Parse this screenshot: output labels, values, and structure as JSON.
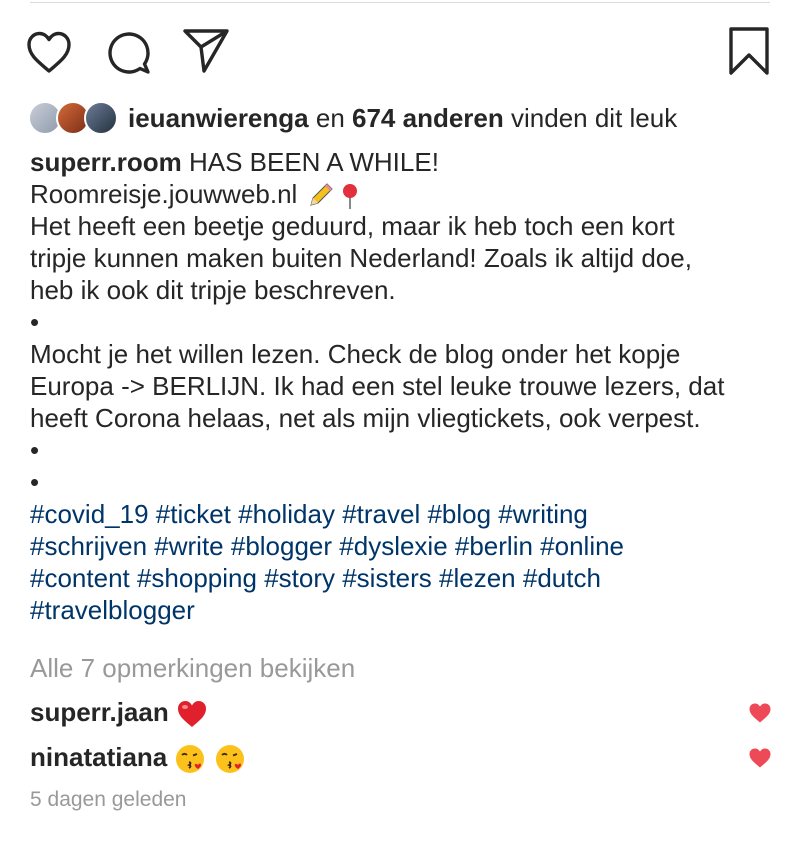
{
  "likes": {
    "user": "ieuanwierenga",
    "connector": "en",
    "count": "674 anderen",
    "suffix": "vinden dit leuk"
  },
  "caption": {
    "username": "superr.room",
    "title": "HAS BEEN A WHILE!",
    "link": "Roomreisje.jouwweb.nl",
    "body_lines": [
      "Het heeft een beetje geduurd, maar ik heb toch een kort",
      "tripje kunnen maken buiten Nederland! Zoals ik altijd doe,",
      "heb ik ook dit tripje beschreven."
    ],
    "dot": "•",
    "body2_lines": [
      "Mocht je het willen lezen. Check de blog onder het kopje",
      "Europa -> BERLIJN. Ik had een stel leuke trouwe lezers, dat",
      "heeft Corona helaas, net als mijn vliegtickets, ook verpest."
    ],
    "hashtag_lines": [
      "#covid_19 #ticket #holiday #travel #blog #writing",
      "#schrijven #write #blogger #dyslexie #berlin #online",
      "#content #shopping #story #sisters #lezen #dutch",
      "#travelblogger"
    ]
  },
  "view_all_comments": "Alle 7 opmerkingen bekijken",
  "comments": [
    {
      "user": "superr.jaan",
      "emoji": [
        "red-heart"
      ]
    },
    {
      "user": "ninatatiana",
      "emoji": [
        "kissing-face",
        "kissing-face"
      ]
    }
  ],
  "timestamp": "5 dagen geleden",
  "colors": {
    "hashtag": "#003569",
    "muted": "#999999",
    "like_heart": "#ed4956"
  },
  "icons": [
    "heart-icon",
    "comment-icon",
    "share-icon",
    "bookmark-icon"
  ]
}
